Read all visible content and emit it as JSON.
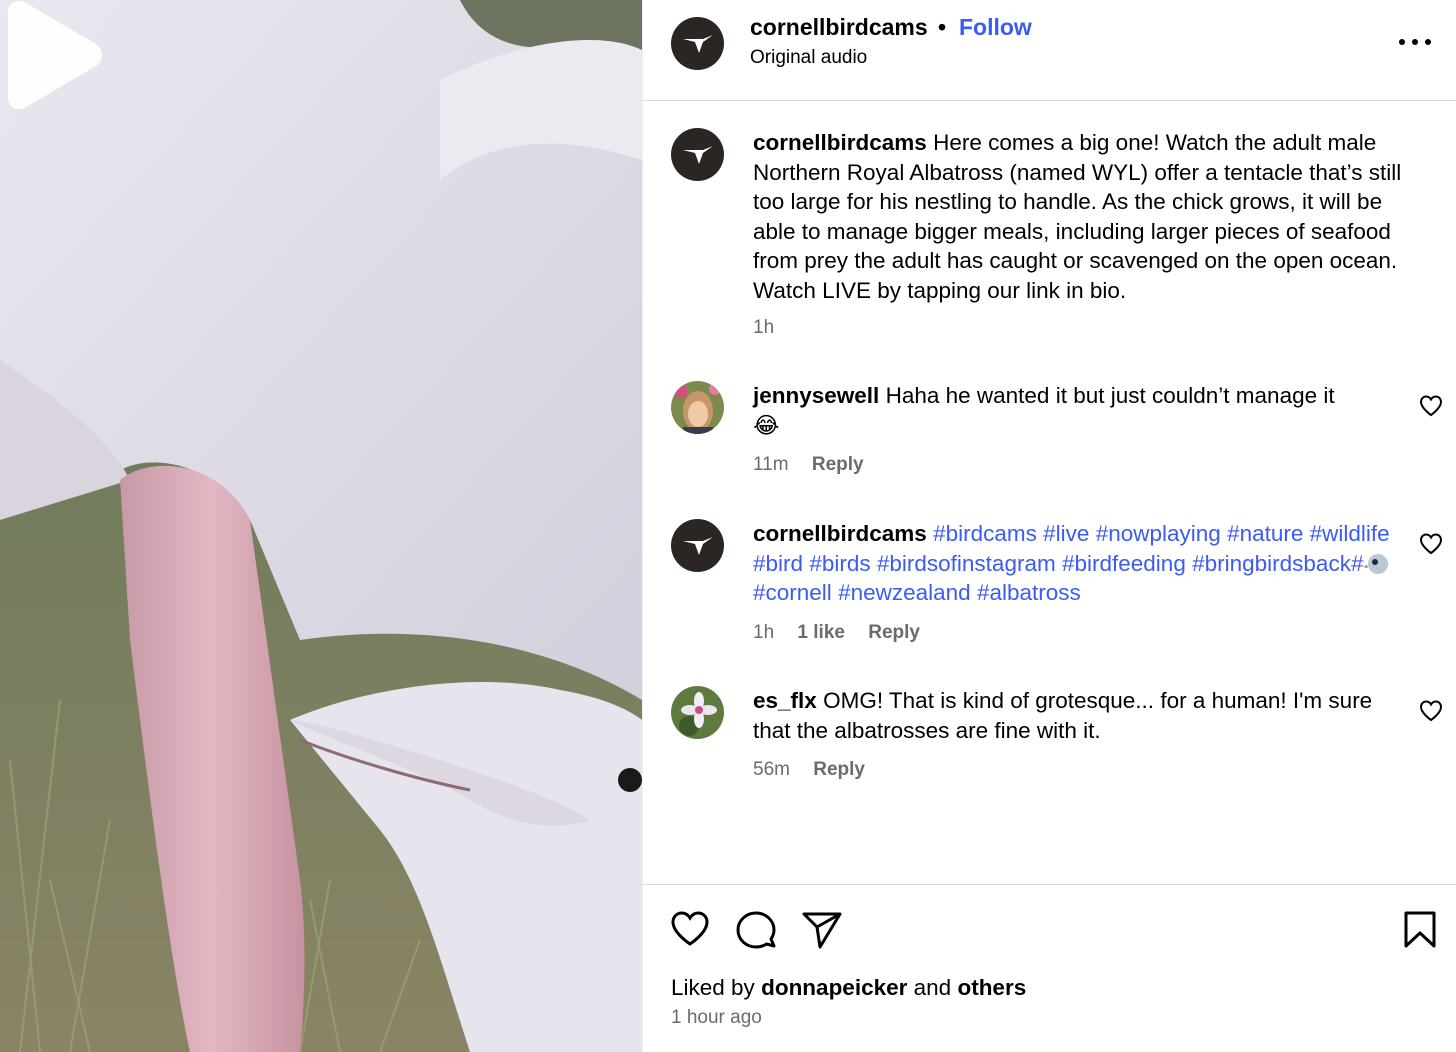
{
  "header": {
    "username": "cornellbirdcams",
    "separator": "•",
    "follow_label": "Follow",
    "audio_label": "Original audio"
  },
  "caption": {
    "username": "cornellbirdcams",
    "text": "Here comes a big one! Watch the adult male Northern Royal Albatross (named WYL) offer a tentacle that’s still too large for his nestling to handle. As the chick grows, it will be able to manage bigger meals, including larger pieces of seafood from prey the adult has caught or scavenged on the open ocean. Watch LIVE by tapping our link in bio.",
    "time": "1h"
  },
  "comments": [
    {
      "username": "jennysewell",
      "text": "Haha he wanted it but just couldn’t manage it",
      "emoji": "😂",
      "time": "11m",
      "reply_label": "Reply"
    },
    {
      "username": "cornellbirdcams",
      "hashtags": [
        "#birdcams",
        "#live",
        "#nowplaying",
        "#nature",
        "#wildlife",
        "#bird",
        "#birds",
        "#birdsofinstagram",
        "#birdfeeding",
        "#bringbirdsback",
        "#",
        "#cornell",
        "#newzealand",
        "#albatross"
      ],
      "time": "1h",
      "likes_label": "1 like",
      "reply_label": "Reply"
    },
    {
      "username": "es_flx",
      "text": "OMG! That is kind of grotesque... for a human! I'm sure that the albatrosses are fine with it.",
      "time": "56m",
      "reply_label": "Reply"
    }
  ],
  "footer": {
    "liked_prefix": "Liked by",
    "liked_user": "donnapeicker",
    "liked_and": "and",
    "liked_others": "others",
    "time_ago": "1 hour ago"
  },
  "icons": {
    "more": "more-options-icon",
    "like": "heart-icon",
    "comment": "comment-bubble-icon",
    "share": "paper-plane-icon",
    "save": "bookmark-icon",
    "play": "play-icon"
  },
  "colors": {
    "link_blue": "#3b5bf6",
    "muted_text": "#6b6b6b",
    "avatar_dark": "#2b2523"
  }
}
